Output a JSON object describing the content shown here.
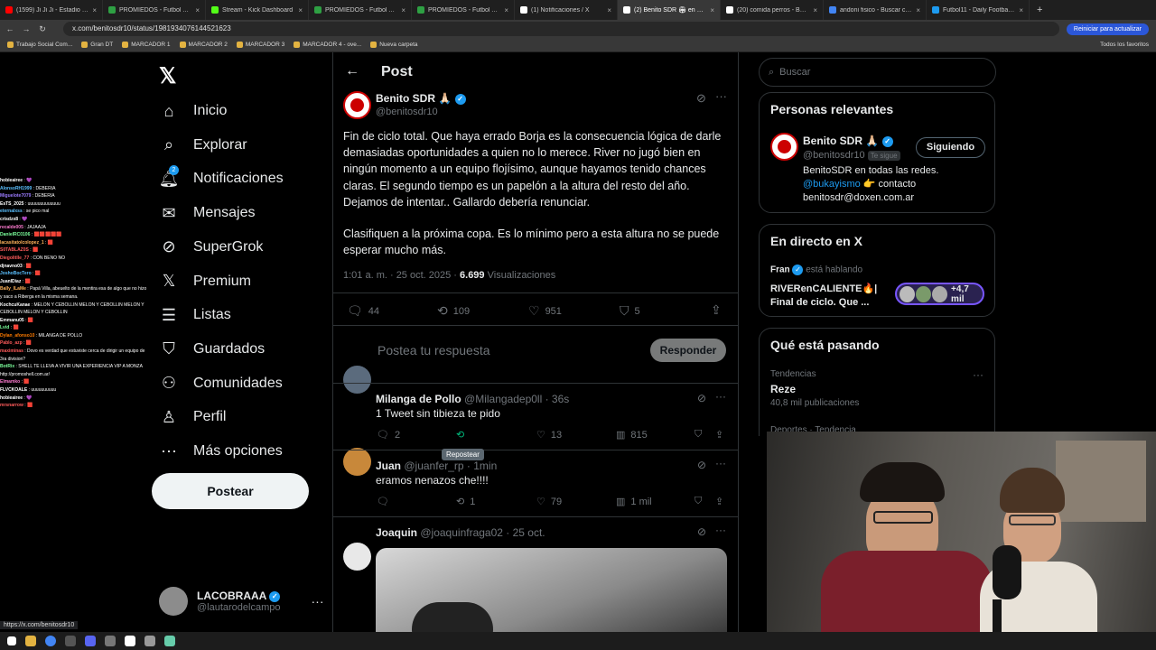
{
  "browser": {
    "tabs": [
      {
        "title": "(1599) Ji Ji Ji - Estadio Único d",
        "color": "#ff0000"
      },
      {
        "title": "PROMIEDOS - Futbol Argentin",
        "color": "#2ea043"
      },
      {
        "title": "Stream - Kick Dashboard",
        "color": "#53fc18"
      },
      {
        "title": "PROMIEDOS - Futbol Argentin",
        "color": "#2ea043"
      },
      {
        "title": "PROMIEDOS - Futbol Argentin",
        "color": "#2ea043"
      },
      {
        "title": "(1) Notificaciones / X",
        "color": "#ffffff"
      },
      {
        "title": "(2) Benito SDR 🏟 en X: \"Fin d",
        "color": "#ffffff"
      },
      {
        "title": "(20) comida perros - Buscar",
        "color": "#ffffff"
      },
      {
        "title": "andoni fisico - Buscar con Go",
        "color": "#4285f4"
      },
      {
        "title": "Futbol11 - Daily Football Gam",
        "color": "#1d9bf0"
      }
    ],
    "url": "x.com/benitosdr10/status/1981934076144521623",
    "update_label": "Reiniciar para actualizar",
    "bookmarks": [
      "Trabajo Social Com...",
      "Gran DT",
      "MARCADOR 1",
      "MARCADOR 2",
      "MARCADOR 3",
      "MARCADOR 4 - ove...",
      "Nueva carpeta"
    ],
    "all_bookmarks": "Todos los favoritos",
    "status_url": "https://x.com/benitosdr10"
  },
  "nav": {
    "items": [
      {
        "label": "Inicio",
        "icon": "home-icon"
      },
      {
        "label": "Explorar",
        "icon": "search-icon"
      },
      {
        "label": "Notificaciones",
        "icon": "bell-icon",
        "badge": "2"
      },
      {
        "label": "Mensajes",
        "icon": "mail-icon"
      },
      {
        "label": "SuperGrok",
        "icon": "grok-icon"
      },
      {
        "label": "Premium",
        "icon": "x-icon"
      },
      {
        "label": "Listas",
        "icon": "list-icon"
      },
      {
        "label": "Guardados",
        "icon": "bookmark-icon"
      },
      {
        "label": "Comunidades",
        "icon": "people-icon"
      },
      {
        "label": "Perfil",
        "icon": "person-icon"
      },
      {
        "label": "Más opciones",
        "icon": "more-icon"
      }
    ],
    "post_label": "Postear",
    "profile_name": "LACOBRAAA",
    "profile_handle": "@lautarodelcampo"
  },
  "post": {
    "header": "Post",
    "author": "Benito SDR",
    "author_emoji": "🙏🏻",
    "handle": "@benitosdr10",
    "text1": "Fin de ciclo total. Que haya errado Borja es la consecuencia lógica de darle demasiadas oportunidades a quien no lo merece. River no jugó bien en ningún momento a un equipo flojísimo, aunque hayamos tenido chances claras. El segundo tiempo es un papelón a la altura del resto del año. Dejamos de intentar.. Gallardo debería renunciar.",
    "text2": "Clasifiquen a la próxima copa. Es lo mínimo pero a esta altura no se puede esperar mucho más.",
    "time": "1:01 a. m. · 25 oct. 2025 · ",
    "views": "6.699",
    "views_label": "Visualizaciones",
    "replies": "44",
    "reposts": "109",
    "likes": "951",
    "bookmarks": "5",
    "reply_placeholder": "Postea tu respuesta",
    "reply_btn": "Responder"
  },
  "replies": [
    {
      "name": "Milanga de Pollo",
      "handle": "@Milangadep0ll · 36s",
      "text": "1 Tweet sin tibieza te pido",
      "replies": "2",
      "reposts": "",
      "likes": "13",
      "views": "815",
      "avatar": "#c8883a"
    },
    {
      "name": "Juan",
      "handle": "@juanfer_rp · 1min",
      "text": "eramos nenazos che!!!!",
      "replies": "",
      "reposts": "1",
      "likes": "79",
      "views": "1 mil",
      "avatar": "#e8e8e8"
    },
    {
      "name": "Joaquin",
      "handle": "@joaquinfraga02 · 25 oct.",
      "text": "",
      "avatar": "#6b4a2e"
    }
  ],
  "tooltip": "Repostear",
  "right": {
    "search_placeholder": "Buscar",
    "relevant_title": "Personas relevantes",
    "rel_name": "Benito SDR 🙏🏻",
    "rel_handle": "@benitosdr10",
    "rel_follows": "Te sigue",
    "rel_following_btn": "Siguiendo",
    "rel_bio_1": "BenitoSDR en todas las redes.",
    "rel_bio_link": "@bukayismo",
    "rel_bio_2": " 👉 contacto",
    "rel_bio_3": "benitosdr@doxen.com.ar",
    "live_title": "En directo en X",
    "live_host": "Fran",
    "live_status": "está hablando",
    "live_text_1": "RIVERenCALIENTE🔥|",
    "live_text_2": "Final de ciclo. Que ...",
    "live_count": "+4,7 mil",
    "trend_title": "Qué está pasando",
    "trend_cat": "Tendencias",
    "trend_name": "Reze",
    "trend_posts": "40,8 mil publicaciones",
    "trend_cat2": "Deportes · Tendencia"
  },
  "chat": [
    {
      "u": "hobieairee",
      "m": "💜",
      "c": "#ffffff"
    },
    {
      "u": "AlonsoRH1999",
      "m": "DEBERIA",
      "c": "#5bc0ff"
    },
    {
      "u": "Miguelote7079",
      "m": "DEBERIA",
      "c": "#9b7bff"
    },
    {
      "u": "EsTS_2025",
      "m": "uuuuuuuuuuuuu",
      "c": "#ffffff"
    },
    {
      "u": "eternalxss",
      "m": "se pico mal",
      "c": "#5bc0ff"
    },
    {
      "u": "crisdzx8",
      "m": "💜",
      "c": "#ffffff"
    },
    {
      "u": "recalde005",
      "m": "JAJAAJA",
      "c": "#ff7bd1"
    },
    {
      "u": "DanielRC0106",
      "m": "🟥🟥🟥🟥🟥",
      "c": "#7bff9b"
    },
    {
      "u": "lacasitatolcolopez_1",
      "m": "🟥",
      "c": "#ffb35b"
    },
    {
      "u": "S0TABLAZ0S",
      "m": "🟥",
      "c": "#ff5b5b"
    },
    {
      "u": "Diegolitlle_77",
      "m": "CON BENO NO",
      "c": "#ff5b5b"
    },
    {
      "u": "djnavno03",
      "m": "🟥",
      "c": "#ffffff"
    },
    {
      "u": "JoshoBocTero",
      "m": "🟥",
      "c": "#5bc0ff"
    },
    {
      "u": "JuanIDiaz",
      "m": "🟥",
      "c": "#ffffff"
    },
    {
      "u": "Bally_ILaMe",
      "m": "Papá Villa, abeuelto de la mentira esa de algo que no hizo y saco a Riberga en la misma semana.",
      "c": "#ffb35b"
    },
    {
      "u": "KochcuKanae",
      "m": "MELON Y CEBOLLIN MELON Y CEBOLLIN MELON Y CEBOLLIN MELON Y CEBOLLIN",
      "c": "#ffffff"
    },
    {
      "u": "Emmanu05",
      "m": "🟥",
      "c": "#ffffff"
    },
    {
      "u": "Lvid",
      "m": "🟥",
      "c": "#7bff9b"
    },
    {
      "u": "Dylan_afonso10",
      "m": "MILANGA DE POLLO",
      "c": "#ff7b00"
    },
    {
      "u": "Pablo_azp",
      "m": "🟥",
      "c": "#ff5b5b"
    },
    {
      "u": "maximinas",
      "m": "Dovo es verdad que estuviste cerca de dirigir un equipo de 3ra division?",
      "c": "#ff5b5b"
    },
    {
      "u": "BotRix",
      "m": "SHELL TE LLEVA A VIVIR UNA EXPERIENCIA VIP A MONZA http://promoshell.com.ar/",
      "c": "#7bff9b"
    },
    {
      "u": "Elmamko",
      "m": "🟥",
      "c": "#ff7bd1"
    },
    {
      "u": "FLVCKOALE",
      "m": "uuuuuuuuuu",
      "c": "#ffffff"
    },
    {
      "u": "hobieairee",
      "m": "💜",
      "c": "#ffffff"
    },
    {
      "u": "mrsnarrow",
      "m": "🟥",
      "c": "#ff5b5b"
    }
  ]
}
